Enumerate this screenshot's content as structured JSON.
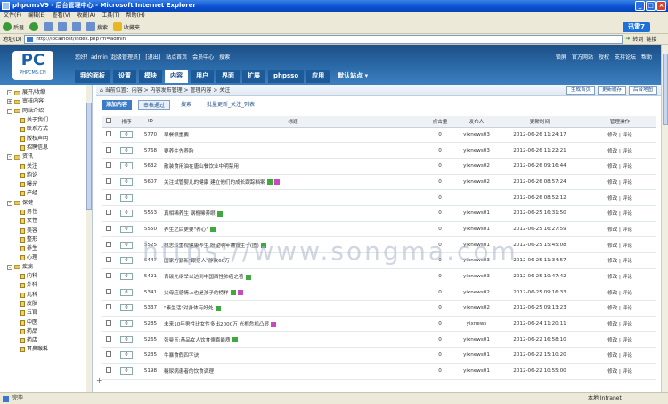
{
  "window": {
    "title": "phpcmsV9 - 后台管理中心 - Microsoft Internet Explorer"
  },
  "menu": [
    "文件(F)",
    "编辑(E)",
    "查看(V)",
    "收藏(A)",
    "工具(T)",
    "帮助(H)"
  ],
  "toolbar": {
    "back": "后退",
    "search": "搜索",
    "favorites": "收藏夹",
    "xunlei": "迅雷7"
  },
  "address": {
    "label": "地址(D)",
    "url": "http://localhost/index.php?m=admin",
    "go": "转到",
    "links": "链接"
  },
  "header": {
    "logo": "PC",
    "logo_sub": "PHPCMS.CN",
    "welcome": [
      "您好！admin [超级管理员]",
      "[退出]",
      "站点首页",
      "会员中心",
      "搜索"
    ],
    "right_links": [
      "锁屏",
      "官方网站",
      "授权",
      "支持论坛",
      "帮助"
    ],
    "tabs": [
      "我的面板",
      "设置",
      "模块",
      "内容",
      "用户",
      "界面",
      "扩展",
      "phpsso",
      "应用",
      "默认站点"
    ],
    "active_tab": "内容"
  },
  "sidebar": {
    "nodes": [
      {
        "label": "展开/收缩",
        "level": 0,
        "toggle": "-"
      },
      {
        "label": "审核内容",
        "level": 0,
        "toggle": "+"
      },
      {
        "label": "网站介绍",
        "level": 0,
        "toggle": "-"
      },
      {
        "label": "关于我们",
        "level": 1
      },
      {
        "label": "联系方式",
        "level": 1
      },
      {
        "label": "版权声明",
        "level": 1
      },
      {
        "label": "招聘信息",
        "level": 1
      },
      {
        "label": "资讯",
        "level": 0,
        "toggle": "-"
      },
      {
        "label": "关注",
        "level": 1
      },
      {
        "label": "韵论",
        "level": 1
      },
      {
        "label": "曝光",
        "level": 1
      },
      {
        "label": "产经",
        "level": 1
      },
      {
        "label": "保健",
        "level": 0,
        "toggle": "-"
      },
      {
        "label": "男性",
        "level": 1
      },
      {
        "label": "女性",
        "level": 1
      },
      {
        "label": "美容",
        "level": 1
      },
      {
        "label": "整形",
        "level": 1
      },
      {
        "label": "养生",
        "level": 1
      },
      {
        "label": "心理",
        "level": 1
      },
      {
        "label": "疾病",
        "level": 0,
        "toggle": "-"
      },
      {
        "label": "内科",
        "level": 1
      },
      {
        "label": "外科",
        "level": 1
      },
      {
        "label": "儿科",
        "level": 1
      },
      {
        "label": "皮肤",
        "level": 1
      },
      {
        "label": "五官",
        "level": 1
      },
      {
        "label": "中医",
        "level": 1
      },
      {
        "label": "药品",
        "level": 1
      },
      {
        "label": "药店",
        "level": 1
      },
      {
        "label": "耳鼻喉科",
        "level": 1
      }
    ]
  },
  "breadcrumb": "当前位置：内容 > 内容发布管理 > 管理内容 > 关注",
  "crumb_buttons": [
    "生成首页",
    "更新缓存",
    "后台地图"
  ],
  "subbar": [
    "添加内容",
    "审核通过",
    "搜索",
    "批量更新_关注_列表"
  ],
  "table": {
    "headers": [
      "",
      "排序",
      "ID",
      "标题",
      "点击量",
      "发布人",
      "更新时间",
      "管理操作"
    ],
    "rows": [
      {
        "sort": "0",
        "id": "5770",
        "title": "早餐很重要",
        "icons": [],
        "hits": "0",
        "author": "yixnews03",
        "time": "2012-06-26 11:24:17",
        "ops": "修改 | 评论"
      },
      {
        "sort": "0",
        "id": "5768",
        "title": "要养生先养胎",
        "icons": [],
        "hits": "0",
        "author": "yixnews03",
        "time": "2012-06-26 11:22:21",
        "ops": "修改 | 评论"
      },
      {
        "sort": "0",
        "id": "5632",
        "title": "散装食用油在唐山餐饮业中明禁用",
        "icons": [],
        "hits": "0",
        "author": "yixnews02",
        "time": "2012-06-26 09:16:44",
        "ops": "修改 | 评论"
      },
      {
        "sort": "0",
        "id": "5607",
        "title": "关注试管婴儿的健康 建立他们的成长跟踪档案",
        "icons": [
          "img",
          "pos"
        ],
        "hits": "0",
        "author": "yixnews02",
        "time": "2012-06-26 08:57:24",
        "ops": "修改 | 评论"
      },
      {
        "sort": "0",
        "id": "",
        "title": "",
        "icons": [],
        "hits": "0",
        "author": "",
        "time": "2012-06-26 08:52:12",
        "ops": "修改 | 评论"
      },
      {
        "sort": "0",
        "id": "5553",
        "title": "真相稀养生 钢棍稀养眼",
        "icons": [
          "img"
        ],
        "hits": "0",
        "author": "yixnews01",
        "time": "2012-06-25 16:31:50",
        "ops": "修改 | 评论"
      },
      {
        "sort": "0",
        "id": "5550",
        "title": "养生之后更要\"养心\"",
        "icons": [
          "img"
        ],
        "hits": "0",
        "author": "yixnews01",
        "time": "2012-06-25 16:27:59",
        "ops": "修改 | 评论"
      },
      {
        "sort": "0",
        "id": "5525",
        "title": "林志玲重视健康养生 盼望明年铺馒生子(图)",
        "icons": [
          "img"
        ],
        "hits": "0",
        "author": "yixnews01",
        "time": "2012-06-25 15:45:08",
        "ops": "修改 | 评论"
      },
      {
        "sort": "0",
        "id": "5447",
        "title": "国家方勤新\"跟搭人\"静款60万",
        "icons": [],
        "hits": "0",
        "author": "yixnews03",
        "time": "2012-06-25 11:34:57",
        "ops": "修改 | 评论"
      },
      {
        "sort": "0",
        "id": "5421",
        "title": "青碳先纲举以达到中国西性肺癌之著",
        "icons": [
          "img"
        ],
        "hits": "0",
        "author": "yixnews03",
        "time": "2012-06-25 10:47:42",
        "ops": "修改 | 评论"
      },
      {
        "sort": "0",
        "id": "5341",
        "title": "父母应感情上也是孩子的榜样",
        "icons": [
          "img",
          "pos"
        ],
        "hits": "0",
        "author": "yixnews02",
        "time": "2012-06-25 09:16:33",
        "ops": "修改 | 评论"
      },
      {
        "sort": "0",
        "id": "5337",
        "title": "\"素生活\"对身体有好处",
        "icons": [
          "img"
        ],
        "hits": "0",
        "author": "yixnews02",
        "time": "2012-06-25 09:13:23",
        "ops": "修改 | 评论"
      },
      {
        "sort": "0",
        "id": "5285",
        "title": "未来10年男性比女性多出2000万 光棍危机凸显",
        "icons": [
          "pos"
        ],
        "hits": "0",
        "author": "yixnews",
        "time": "2012-06-24 11:20:11",
        "ops": "修改 | 评论"
      },
      {
        "sort": "0",
        "id": "5265",
        "title": "张曼玉:恭品女人饮食僵喜能质",
        "icons": [
          "img"
        ],
        "hits": "0",
        "author": "yixnews01",
        "time": "2012-06-22 16:58:10",
        "ops": "修改 | 评论"
      },
      {
        "sort": "0",
        "id": "5235",
        "title": "牛暴食假四字诀",
        "icons": [],
        "hits": "0",
        "author": "yixnews01",
        "time": "2012-06-22 15:10:20",
        "ops": "修改 | 评论"
      },
      {
        "sort": "0",
        "id": "5198",
        "title": "糖尿病患者的饮食调理",
        "icons": [],
        "hits": "0",
        "author": "yixnews01",
        "time": "2012-06-22 10:55:00",
        "ops": "修改 | 评论"
      }
    ]
  },
  "watermark": "https://www.songma.com",
  "status": {
    "text": "完毕",
    "zone": "本地 Intranet"
  },
  "colors": {
    "header": "#2b6aa8",
    "accent": "#3d7cc4",
    "xp_title": "#0a4fd0"
  }
}
